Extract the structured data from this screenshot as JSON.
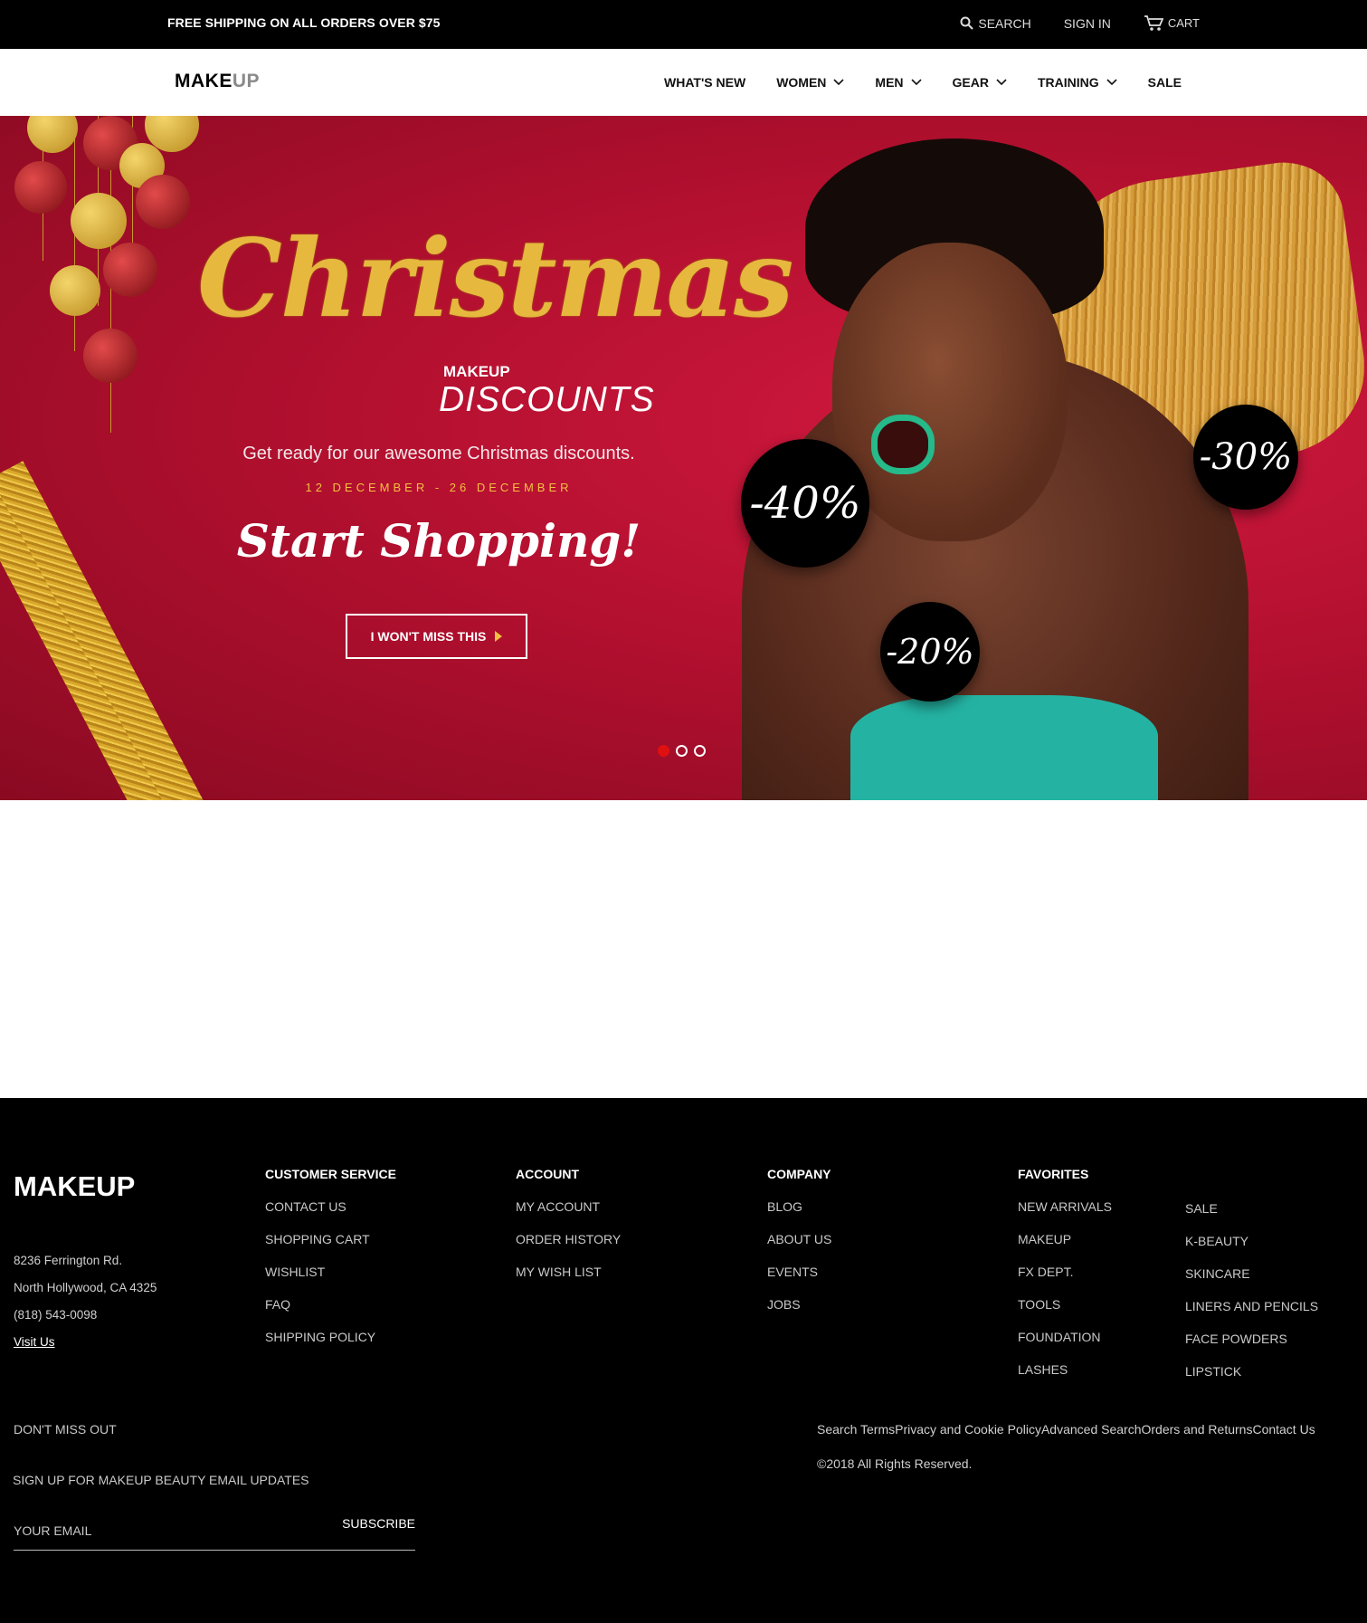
{
  "topbar": {
    "promo": "FREE SHIPPING ON ALL ORDERS OVER $75",
    "search": "SEARCH",
    "sign_in": "SIGN IN",
    "cart": "CART"
  },
  "header": {
    "logo_make": "MAKE",
    "logo_up": "UP",
    "nav": [
      {
        "label": "WHAT'S NEW"
      },
      {
        "label": "WOMEN"
      },
      {
        "label": "MEN"
      },
      {
        "label": "GEAR"
      },
      {
        "label": "TRAINING"
      },
      {
        "label": "SALE"
      }
    ]
  },
  "hero": {
    "script_title": "Christmas",
    "makeup": "MAKEUP",
    "discounts": "DISCOUNTS",
    "tagline": "Get ready for our awesome Christmas discounts.",
    "dates": "12 DECEMBER - 26 DECEMBER",
    "start_shopping": "Start Shopping!",
    "cta": "I WON'T MISS THIS",
    "badges": [
      "-40%",
      "-30%",
      "-20%"
    ],
    "slide_active": 1,
    "slide_count": 3
  },
  "footer": {
    "logo": "MAKEUP",
    "address": [
      "8236 Ferrington Rd.",
      "North Hollywood, CA 4325",
      "(818) 543-0098"
    ],
    "visit": "Visit Us",
    "customer_service": {
      "title": "CUSTOMER SERVICE",
      "items": [
        "CONTACT US",
        "SHOPPING CART",
        "WISHLIST",
        "FAQ",
        "SHIPPING POLICY"
      ]
    },
    "account": {
      "title": "ACCOUNT",
      "items": [
        "MY ACCOUNT",
        "ORDER HISTORY",
        "MY WISH LIST"
      ]
    },
    "company": {
      "title": "COMPANY",
      "items": [
        "BLOG",
        "ABOUT US",
        "EVENTS",
        "JOBS"
      ]
    },
    "favorites": {
      "title": "FAVORITES",
      "items_left": [
        "NEW ARRIVALS",
        "MAKEUP",
        "FX DEPT.",
        "TOOLS",
        "FOUNDATION",
        "LASHES"
      ],
      "items_right": [
        "SALE",
        "K-BEAUTY",
        "SKINCARE",
        "LINERS AND PENCILS",
        "FACE POWDERS",
        "LIPSTICK"
      ]
    },
    "dont_miss": "DON'T MISS OUT",
    "sign_up": "SIGN UP FOR MAKEUP BEAUTY EMAIL UPDATES",
    "email_placeholder": "YOUR EMAIL",
    "subscribe": "SUBSCRIBE",
    "bottom_links": [
      "Search Terms",
      "Privacy and Cookie Policy",
      "Advanced Search",
      "Orders and Returns",
      "Contact Us"
    ],
    "copyright": "©2018 All Rights Reserved."
  },
  "colors": {
    "hero_red": "#b4102f",
    "gold": "#e6b83e",
    "dot_active": "#e01010",
    "teal": "#24b3a3"
  },
  "icons": [
    "search-icon",
    "cart-icon",
    "chevron-down-icon",
    "play-triangle-icon"
  ]
}
